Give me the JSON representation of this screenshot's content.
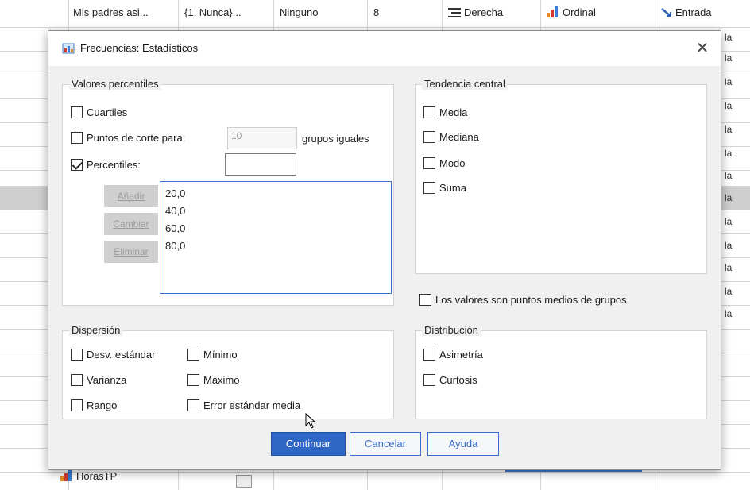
{
  "background": {
    "top_row": {
      "name": "Mis padres asi...",
      "values": "{1, Nunca}...",
      "missing": "Ninguno",
      "columns": "8",
      "align": "Derecha",
      "measure": "Ordinal",
      "role": "Entrada"
    },
    "side_text": "la",
    "bottom_variable": "HorasTP"
  },
  "dialog": {
    "title": "Frecuencias: Estadísticos",
    "close_glyph": "✕",
    "percentiles": {
      "title": "Valores percentiles",
      "quartiles": "Cuartiles",
      "cut_points": "Puntos de corte para:",
      "cut_points_value": "10",
      "equal_groups": "grupos iguales",
      "percentiles": "Percentiles:",
      "percentile_input": "",
      "add": "Añadir",
      "change": "Cambiar",
      "remove": "Eliminar",
      "list": [
        "20,0",
        "40,0",
        "60,0",
        "80,0"
      ]
    },
    "central": {
      "title": "Tendencia central",
      "mean": "Media",
      "median": "Mediana",
      "mode": "Modo",
      "sum": "Suma"
    },
    "midpoints": "Los valores son puntos medios de grupos",
    "dispersion": {
      "title": "Dispersión",
      "std_dev": "Desv. estándar",
      "minimum": "Mínimo",
      "variance": "Varianza",
      "maximum": "Máximo",
      "range": "Rango",
      "std_error": "Error estándar media"
    },
    "distribution": {
      "title": "Distribución",
      "skewness": "Asimetría",
      "kurtosis": "Curtosis"
    },
    "buttons": {
      "continue": "Continuar",
      "cancel": "Cancelar",
      "help": "Ayuda"
    }
  },
  "colors": {
    "accent": "#2f67c7",
    "dialog_bg": "#f0f0f0"
  }
}
